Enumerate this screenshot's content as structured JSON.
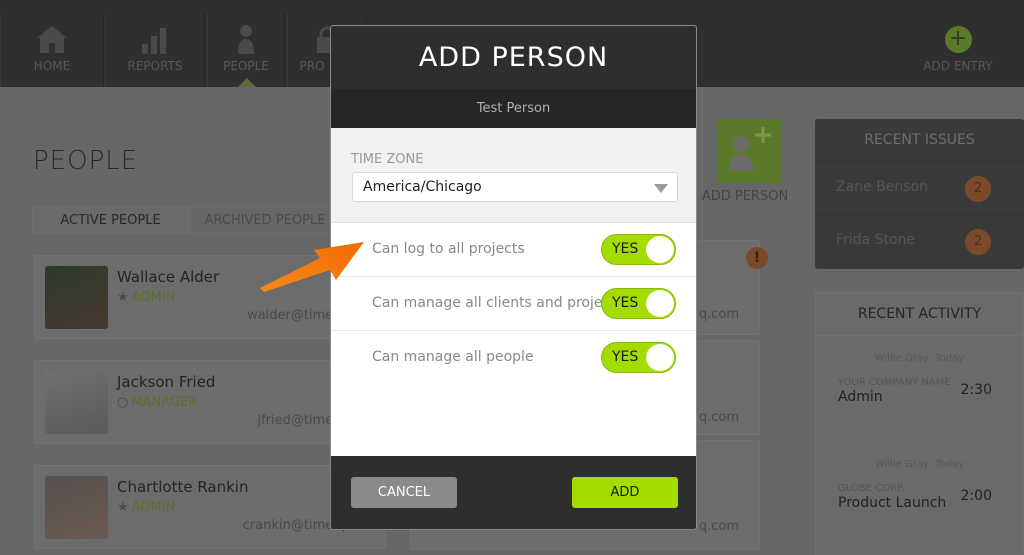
{
  "nav": {
    "items": [
      {
        "label": "HOME",
        "icon": "home-icon"
      },
      {
        "label": "REPORTS",
        "icon": "bar-chart-icon"
      },
      {
        "label": "PEOPLE",
        "icon": "person-icon",
        "active": true
      },
      {
        "label": "PRO",
        "icon": "lock-icon"
      }
    ],
    "add_entry": {
      "label": "ADD ENTRY",
      "icon": "plus-circle-icon"
    }
  },
  "page": {
    "title": "PEOPLE",
    "tabs": [
      {
        "label": "ACTIVE PEOPLE",
        "active": true
      },
      {
        "label": "ARCHIVED PEOPLE"
      }
    ],
    "add_person": "ADD PERSON"
  },
  "people": [
    {
      "name": "Wallace Alder",
      "role": "ADMIN",
      "role_icon": "star-icon",
      "email": "walder@timeiq.com"
    },
    {
      "name": "Jackson Fried",
      "role": "MANAGER",
      "role_icon": "circle-icon",
      "email": "jfried@timeiq.com"
    },
    {
      "name": "Chartlotte Rankin",
      "role": "ADMIN",
      "role_icon": "star-icon",
      "email": "crankin@timeiq.com"
    }
  ],
  "right_cards": [
    {
      "email_fragment": "q.com",
      "alert": "!"
    },
    {
      "email_fragment": "q.com"
    },
    {
      "email_fragment": "q.com"
    }
  ],
  "recent_issues": {
    "title": "RECENT ISSUES",
    "items": [
      {
        "name": "Zane Benson",
        "count": "2"
      },
      {
        "name": "Frida Stone",
        "count": "2"
      }
    ]
  },
  "recent_activity": {
    "title": "RECENT ACTIVITY",
    "items": [
      {
        "who": "Willie Gray, Today",
        "company": "YOUR COMPANY NAME",
        "project": "Admin",
        "time": "2:30"
      },
      {
        "who": "Willie Gray, Today",
        "company": "GLOBE CORP.",
        "project": "Product Launch",
        "time": "2:00"
      }
    ]
  },
  "modal": {
    "title": "ADD PERSON",
    "subtitle": "Test Person",
    "timezone_label": "TIME ZONE",
    "timezone_value": "America/Chicago",
    "permissions": [
      {
        "label": "Can log to all projects",
        "value": "YES"
      },
      {
        "label": "Can manage all clients and projects",
        "value": "YES"
      },
      {
        "label": "Can manage all people",
        "value": "YES"
      }
    ],
    "cancel": "CANCEL",
    "add": "ADD"
  },
  "colors": {
    "accent_green": "#a4dc00",
    "arrow_orange": "#f57c00",
    "badge_orange": "#7a4a2a"
  }
}
